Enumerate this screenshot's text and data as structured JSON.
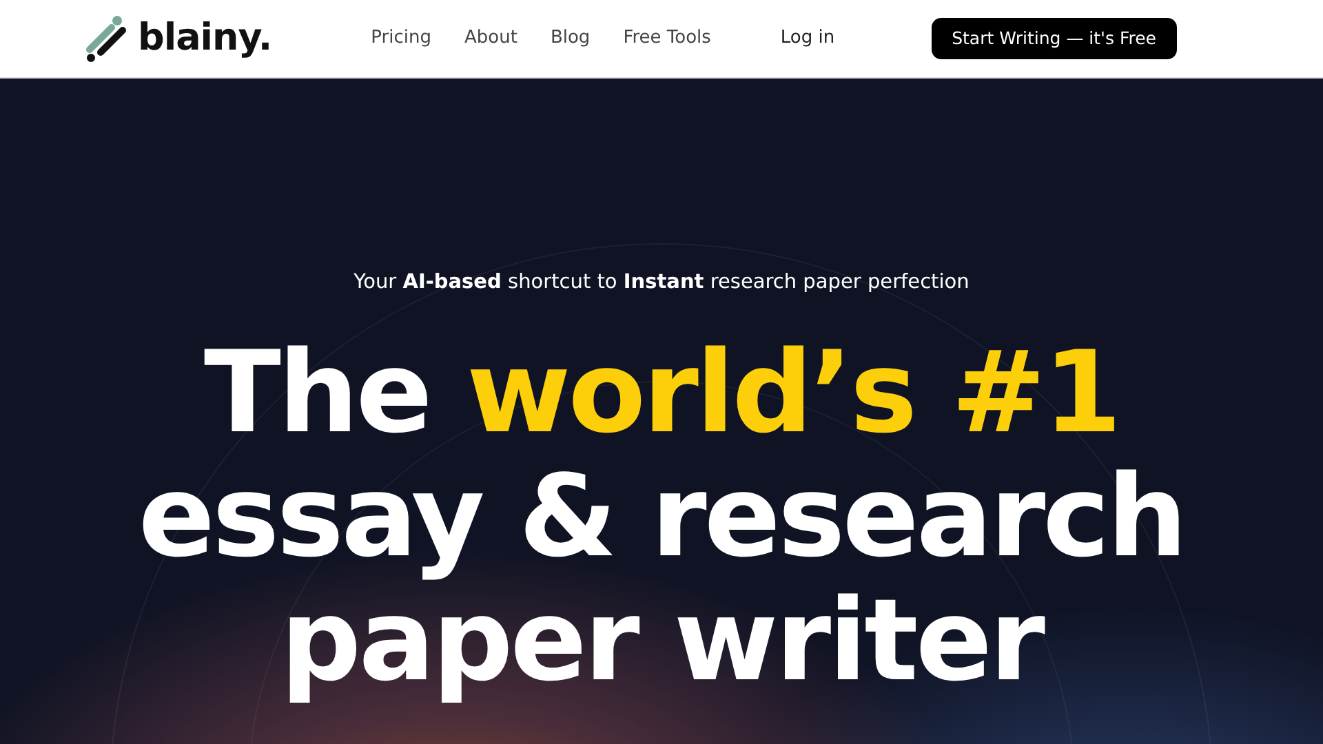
{
  "brand": {
    "name": "blainy."
  },
  "nav": [
    {
      "label": "Pricing"
    },
    {
      "label": "About"
    },
    {
      "label": "Blog"
    },
    {
      "label": "Free Tools"
    }
  ],
  "login": "Log in",
  "cta": "Start Writing — it's Free",
  "hero": {
    "tagline": "Your **AI-based** shortcut to **Instant** research paper perfection",
    "headline": [
      [
        {
          "text": "The ",
          "highlight": false
        },
        {
          "text": "world’s #1",
          "highlight": true
        }
      ],
      [
        {
          "text": "essay & research",
          "highlight": false
        }
      ],
      [
        {
          "text": "paper writer",
          "highlight": false
        }
      ]
    ]
  }
}
